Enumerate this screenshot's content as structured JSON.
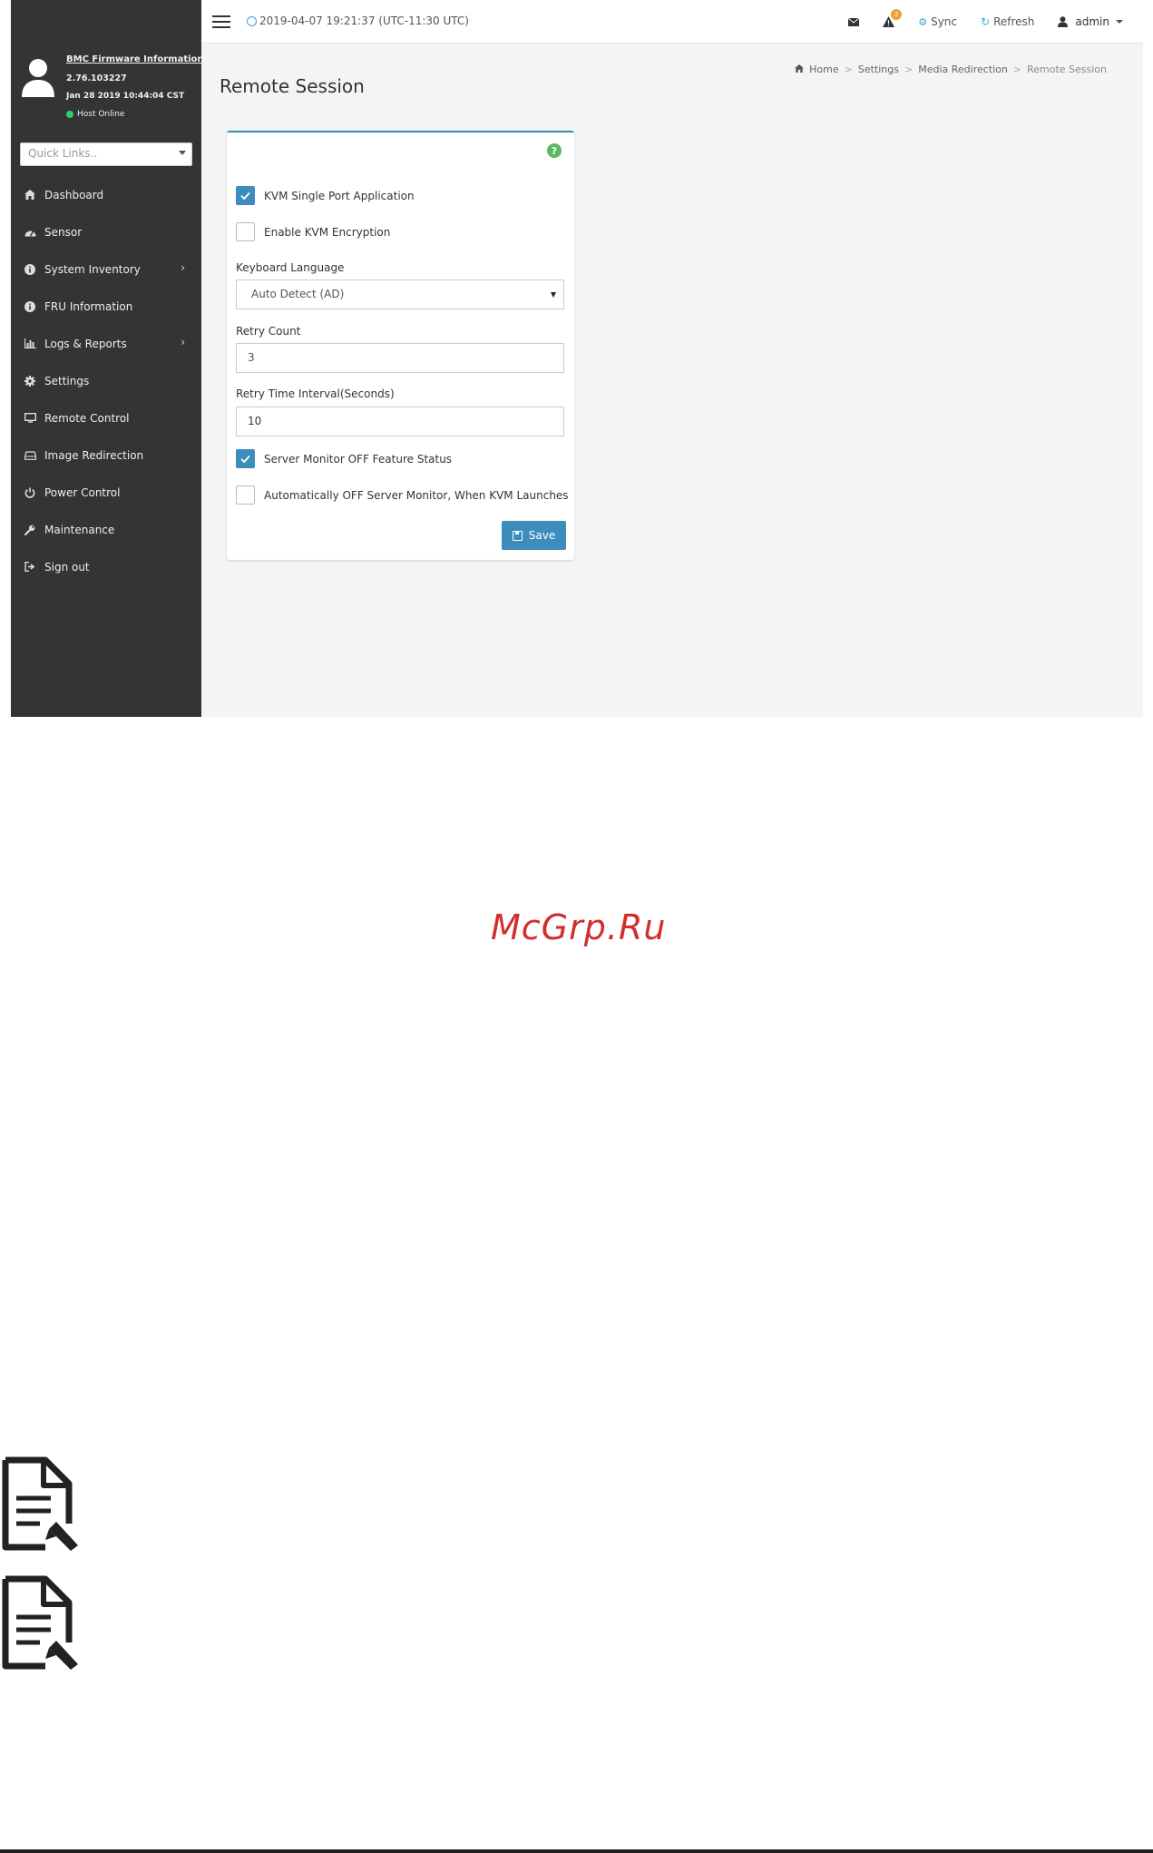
{
  "topbar": {
    "datetime": "2019-04-07 19:21:37 (UTC-11:30 UTC)",
    "alerts_count": "2",
    "sync_label": "Sync",
    "refresh_label": "Refresh",
    "user_label": "admin"
  },
  "sidebar": {
    "fw_title": "BMC Firmware Information",
    "fw_version": "2.76.103227",
    "fw_date": "Jan 28 2019 10:44:04 CST",
    "host_status": "Host Online",
    "quick_links_placeholder": "Quick Links..",
    "items": [
      {
        "label": "Dashboard",
        "icon": "dashboard-icon"
      },
      {
        "label": "Sensor",
        "icon": "sensor-icon"
      },
      {
        "label": "System Inventory",
        "icon": "info-icon",
        "has_submenu": true
      },
      {
        "label": "FRU Information",
        "icon": "info-icon"
      },
      {
        "label": "Logs & Reports",
        "icon": "bar-chart-icon",
        "has_submenu": true
      },
      {
        "label": "Settings",
        "icon": "gear-icon"
      },
      {
        "label": "Remote Control",
        "icon": "monitor-icon"
      },
      {
        "label": "Image Redirection",
        "icon": "disk-drive-icon"
      },
      {
        "label": "Power Control",
        "icon": "power-icon"
      },
      {
        "label": "Maintenance",
        "icon": "wrench-icon"
      },
      {
        "label": "Sign out",
        "icon": "sign-out-icon"
      }
    ]
  },
  "page": {
    "title": "Remote Session",
    "breadcrumb": [
      "Home",
      "Settings",
      "Media Redirection",
      "Remote Session"
    ]
  },
  "form": {
    "kvm_single_port": {
      "label": "KVM Single Port Application",
      "checked": true
    },
    "kvm_encryption": {
      "label": "Enable KVM Encryption",
      "checked": false
    },
    "keyboard_language": {
      "label": "Keyboard Language",
      "value": "Auto Detect (AD)"
    },
    "retry_count": {
      "label": "Retry Count",
      "value": "3"
    },
    "retry_interval": {
      "label": "Retry Time Interval(Seconds)",
      "value": "10"
    },
    "server_monitor_off": {
      "label": "Server Monitor OFF Feature Status",
      "checked": true
    },
    "auto_off_monitor": {
      "label": "Automatically OFF Server Monitor, When KVM Launches",
      "checked": false
    },
    "save_label": "Save"
  },
  "watermark": "McGrp.Ru",
  "colors": {
    "sidebar_bg": "#343434",
    "accent": "#3c8dbc",
    "help_green": "#5cb85c",
    "badge_orange": "#f0a030",
    "watermark_red": "#d02e2e"
  }
}
